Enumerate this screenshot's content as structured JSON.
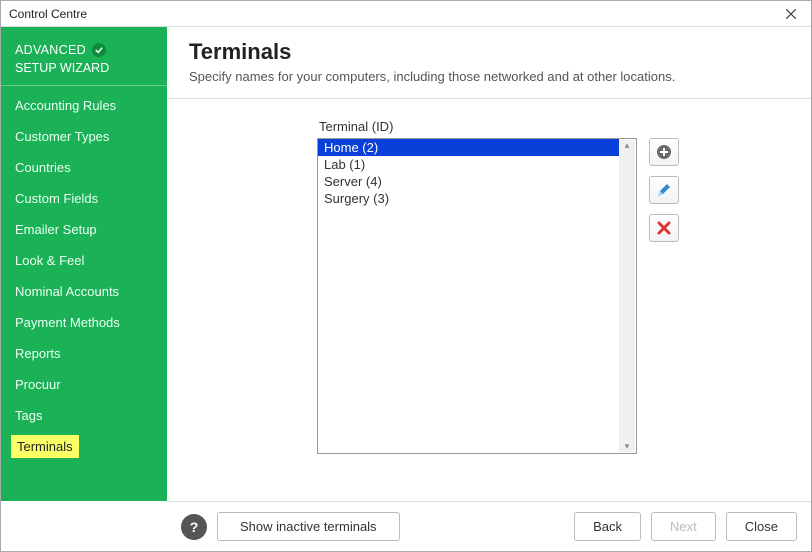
{
  "window": {
    "title": "Control Centre"
  },
  "sidebar": {
    "heading": "ADVANCED",
    "subheading": "SETUP WIZARD",
    "items": [
      {
        "label": "Accounting Rules",
        "active": false
      },
      {
        "label": "Customer Types",
        "active": false
      },
      {
        "label": "Countries",
        "active": false
      },
      {
        "label": "Custom Fields",
        "active": false
      },
      {
        "label": "Emailer Setup",
        "active": false
      },
      {
        "label": "Look & Feel",
        "active": false
      },
      {
        "label": "Nominal Accounts",
        "active": false
      },
      {
        "label": "Payment Methods",
        "active": false
      },
      {
        "label": "Reports",
        "active": false
      },
      {
        "label": "Procuur",
        "active": false
      },
      {
        "label": "Tags",
        "active": false
      },
      {
        "label": "Terminals",
        "active": true
      }
    ]
  },
  "main": {
    "title": "Terminals",
    "description": "Specify names for your computers, including those networked and at other locations.",
    "list_label": "Terminal (ID)",
    "terminals": [
      {
        "display": "Home (2)",
        "selected": true
      },
      {
        "display": "Lab (1)",
        "selected": false
      },
      {
        "display": "Server (4)",
        "selected": false
      },
      {
        "display": "Surgery (3)",
        "selected": false
      }
    ],
    "actions": {
      "add_icon": "add-icon",
      "edit_icon": "edit-icon",
      "delete_icon": "delete-icon"
    }
  },
  "footer": {
    "show_inactive": "Show inactive terminals",
    "back": "Back",
    "next": "Next",
    "close": "Close"
  }
}
